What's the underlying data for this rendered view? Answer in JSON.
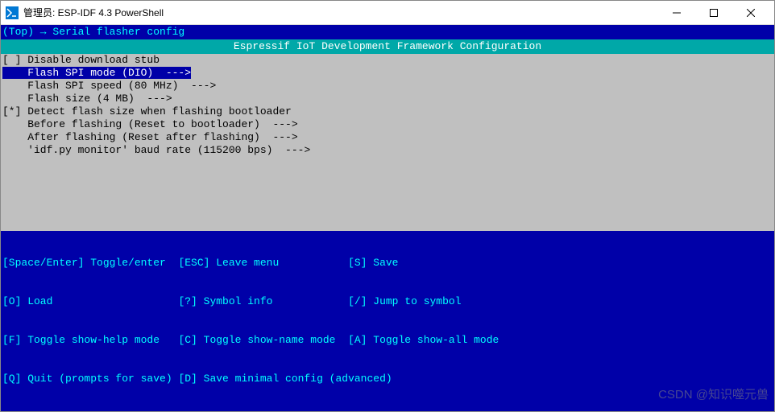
{
  "window": {
    "title": "管理员: ESP-IDF 4.3 PowerShell"
  },
  "breadcrumb": "(Top) → Serial flasher config",
  "config_title": "Espressif IoT Development Framework Configuration",
  "menu": {
    "items": [
      {
        "prefix": "[ ] ",
        "indent": "",
        "label": "Disable download stub",
        "arrow": "",
        "selected": false
      },
      {
        "prefix": "    ",
        "indent": "",
        "label": "Flash SPI mode (DIO)  --->",
        "arrow": "",
        "selected": true
      },
      {
        "prefix": "    ",
        "indent": "",
        "label": "Flash SPI speed (80 MHz)  --->",
        "arrow": "",
        "selected": false
      },
      {
        "prefix": "    ",
        "indent": "",
        "label": "Flash size (4 MB)  --->",
        "arrow": "",
        "selected": false
      },
      {
        "prefix": "[*] ",
        "indent": "",
        "label": "Detect flash size when flashing bootloader",
        "arrow": "",
        "selected": false
      },
      {
        "prefix": "    ",
        "indent": "",
        "label": "Before flashing (Reset to bootloader)  --->",
        "arrow": "",
        "selected": false
      },
      {
        "prefix": "    ",
        "indent": "",
        "label": "After flashing (Reset after flashing)  --->",
        "arrow": "",
        "selected": false
      },
      {
        "prefix": "    ",
        "indent": "",
        "label": "'idf.py monitor' baud rate (115200 bps)  --->",
        "arrow": "",
        "selected": false
      }
    ]
  },
  "help": {
    "row1_col1": "[Space/Enter] Toggle/enter",
    "row1_col2": "[ESC] Leave menu",
    "row1_col3": "[S] Save",
    "row2_col1": "[O] Load",
    "row2_col2": "[?] Symbol info",
    "row2_col3": "[/] Jump to symbol",
    "row3_col1": "[F] Toggle show-help mode",
    "row3_col2": "[C] Toggle show-name mode",
    "row3_col3": "[A] Toggle show-all mode",
    "row4_col1": "[Q] Quit (prompts for save)",
    "row4_col2": "[D] Save minimal config (advanced)",
    "row4_col3": ""
  },
  "watermark": "CSDN @知识噬元兽"
}
